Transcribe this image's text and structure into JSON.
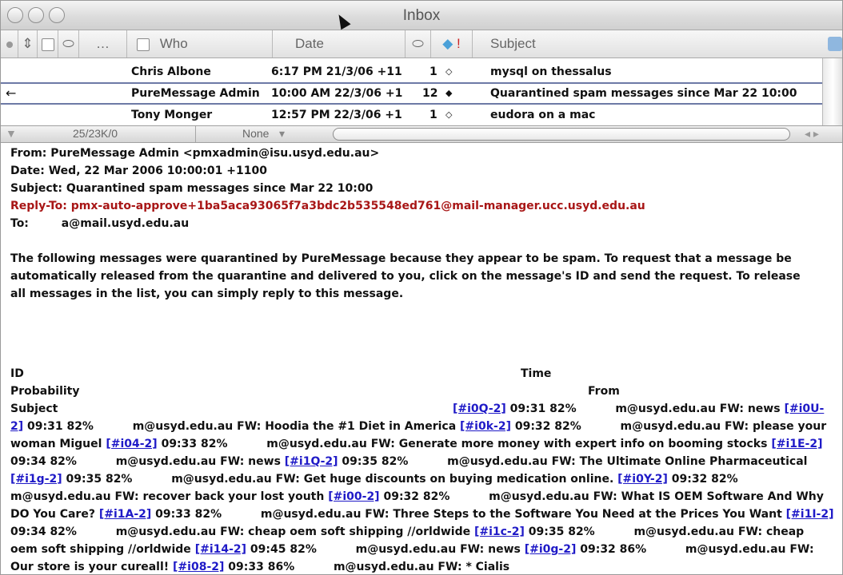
{
  "window": {
    "title": "Inbox"
  },
  "columns": {
    "who": "Who",
    "date": "Date",
    "subject": "Subject"
  },
  "messages": [
    {
      "who": "Chris Albone",
      "date": "6:17 PM 21/3/06 +11",
      "priority": "1",
      "status": "◇",
      "subject": "mysql on thessalus",
      "selected": false
    },
    {
      "who": "PureMessage Admin",
      "date": "10:00 AM 22/3/06 +1",
      "priority": "12",
      "status": "◆",
      "subject": "Quarantined spam messages since Mar 22 10:00",
      "selected": true,
      "indicator": "←"
    },
    {
      "who": "Tony Monger",
      "date": "12:57 PM 22/3/06 +1",
      "priority": "1",
      "status": "◇",
      "subject": "eudora on a mac",
      "selected": false
    }
  ],
  "status": {
    "size": "25/23K/0",
    "label": "None"
  },
  "email": {
    "from": "From: PureMessage Admin <pmxadmin@isu.usyd.edu.au>",
    "date": "Date: Wed, 22 Mar 2006 10:00:01 +1100",
    "subject": "Subject: Quarantined spam messages since Mar 22 10:00",
    "reply_to": "Reply-To: pmx-auto-approve+1ba5aca93065f7a3bdc2b535548ed761@mail-manager.ucc.usyd.edu.au",
    "to_label": "To:",
    "to_value": "a@mail.usyd.edu.au",
    "intro": "The following messages were quarantined by PureMessage because they appear to be spam. To request that a message be automatically released from the quarantine and delivered to you, click on the message's ID and send the request. To release all messages in the list, you can simply reply to this message.",
    "table": {
      "id": "ID",
      "time": "Time",
      "probability": "Probability",
      "from": "From",
      "subject": "Subject"
    },
    "list": [
      {
        "id": "[#i0Q-2]",
        "time": "09:31",
        "prob": "82%",
        "from": "m@usyd.edu.au",
        "subject": "FW: news"
      },
      {
        "id": "[#i0U-2]",
        "time": "09:31",
        "prob": "82%",
        "from": "m@usyd.edu.au",
        "subject": "FW: Hoodia the #1 Diet in America"
      },
      {
        "id": "[#i0k-2]",
        "time": "09:32",
        "prob": "82%",
        "from": "m@usyd.edu.au",
        "subject": "FW: please your woman Miguel"
      },
      {
        "id": "[#i04-2]",
        "time": "09:33",
        "prob": "82%",
        "from": "m@usyd.edu.au",
        "subject": "FW: Generate more money with expert info on booming stocks"
      },
      {
        "id": "[#i1E-2]",
        "time": "09:34",
        "prob": "82%",
        "from": "m@usyd.edu.au",
        "subject": "FW: news"
      },
      {
        "id": "[#i1Q-2]",
        "time": "09:35",
        "prob": "82%",
        "from": "m@usyd.edu.au",
        "subject": "FW: The Ultimate Online Pharmaceutical"
      },
      {
        "id": "[#i1g-2]",
        "time": "09:35",
        "prob": "82%",
        "from": "m@usyd.edu.au",
        "subject": "FW: Get huge discounts on buying medication online."
      },
      {
        "id": "[#i0Y-2]",
        "time": "09:32",
        "prob": "82%",
        "from": "m@usyd.edu.au",
        "subject": "FW: recover back your lost youth"
      },
      {
        "id": "[#i00-2]",
        "time": "09:32",
        "prob": "82%",
        "from": "m@usyd.edu.au",
        "subject": "FW: What IS OEM Software And Why DO You Care?"
      },
      {
        "id": "[#i1A-2]",
        "time": "09:33",
        "prob": "82%",
        "from": "m@usyd.edu.au",
        "subject": "FW: Three Steps to the Software You Need at the Prices You Want"
      },
      {
        "id": "[#i1I-2]",
        "time": "09:34",
        "prob": "82%",
        "from": "m@usyd.edu.au",
        "subject": "FW: cheap oem soft shipping //orldwide"
      },
      {
        "id": "[#i1c-2]",
        "time": "09:35",
        "prob": "82%",
        "from": "m@usyd.edu.au",
        "subject": "FW: cheap oem soft shipping //orldwide"
      },
      {
        "id": "[#i14-2]",
        "time": "09:45",
        "prob": "82%",
        "from": "m@usyd.edu.au",
        "subject": "FW: news"
      },
      {
        "id": "[#i0g-2]",
        "time": "09:32",
        "prob": "86%",
        "from": "m@usyd.edu.au",
        "subject": "FW: Our store is your cureall!"
      },
      {
        "id": "[#i08-2]",
        "time": "09:33",
        "prob": "86%",
        "from": "m@usyd.edu.au",
        "subject": "FW: * Cialis"
      }
    ]
  }
}
